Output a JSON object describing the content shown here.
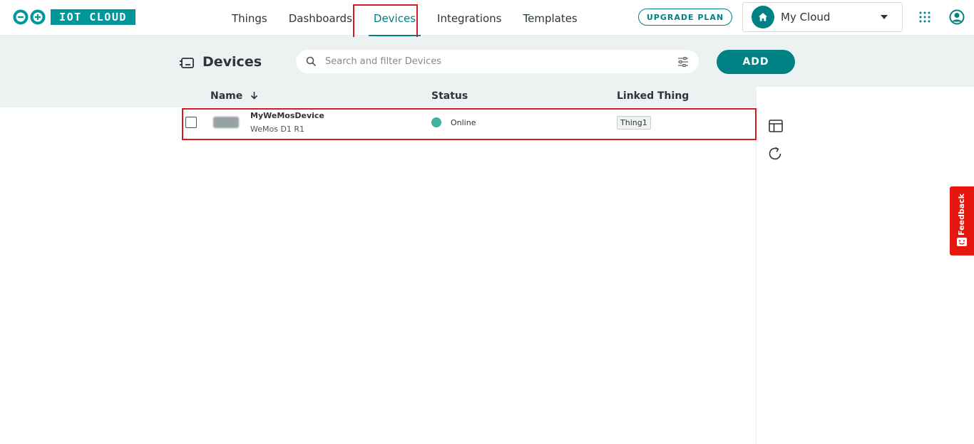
{
  "header": {
    "logo_text": "IOT CLOUD",
    "nav": [
      {
        "label": "Things",
        "active": false
      },
      {
        "label": "Dashboards",
        "active": false
      },
      {
        "label": "Devices",
        "active": true
      },
      {
        "label": "Integrations",
        "active": false
      },
      {
        "label": "Templates",
        "active": false
      }
    ],
    "upgrade_label": "UPGRADE PLAN",
    "space_name": "My Cloud"
  },
  "page": {
    "title": "Devices",
    "search_placeholder": "Search and filter Devices",
    "add_label": "ADD"
  },
  "table": {
    "columns": {
      "name": "Name",
      "status": "Status",
      "linked_thing": "Linked Thing"
    },
    "sort_column": "Name",
    "rows": [
      {
        "name": "MyWeMosDevice",
        "type": "WeMos D1 R1",
        "status": "Online",
        "linked_thing": "Thing1"
      }
    ]
  },
  "feedback_label": "Feedback",
  "colors": {
    "brand": "#00979c",
    "accent": "#008184",
    "online": "#3fb2a0",
    "feedback": "#e5170e",
    "highlight": "#d71920"
  }
}
